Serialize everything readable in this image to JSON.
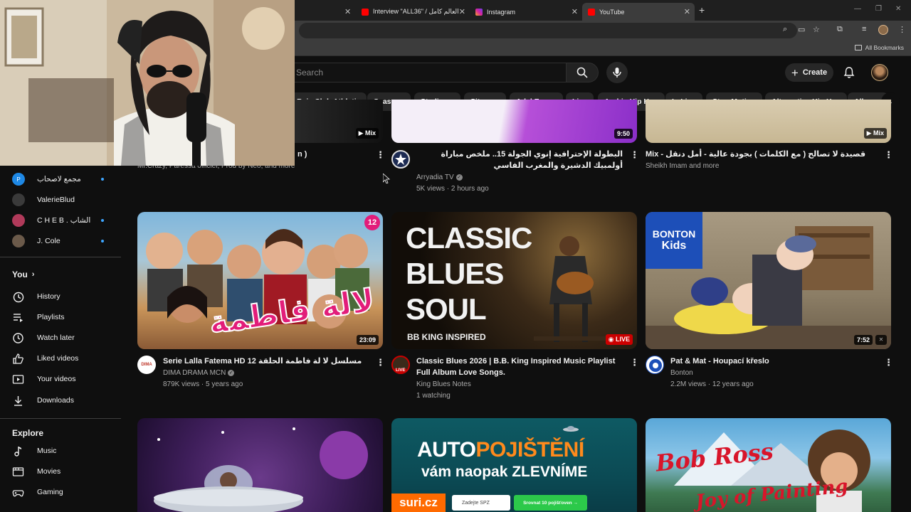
{
  "browser": {
    "tabs": [
      {
        "title": "Interview \"ALL36\" / العالم كامل ...",
        "favicon_color": "#ff0000"
      },
      {
        "title": "Instagram",
        "favicon_color": "#d6249f"
      },
      {
        "title": "YouTube",
        "favicon_color": "#ff0000",
        "active": true
      }
    ],
    "all_bookmarks": "All Bookmarks"
  },
  "header": {
    "search_placeholder": "Search",
    "create_label": "Create"
  },
  "chips": [
    "Raja Club Athletic",
    "Seasons",
    "Stadiums",
    "Sitcoms",
    "Adel Emam",
    "Live",
    "Arabic Hip Hop",
    "LaLiga",
    "Stop Motion",
    "Alternative Hip Hop",
    "Albums"
  ],
  "sidebar": {
    "subscriptions": [
      {
        "name": "مجمع لاصحاب",
        "color": "#1e88e5",
        "dot": true
      },
      {
        "name": "ValerieBlud",
        "color": "#3a3a3a",
        "dot": false
      },
      {
        "name": "C H E B . الشاب",
        "color": "#b03a5a",
        "dot": true
      },
      {
        "name": "J. Cole",
        "color": "#6b5a4a",
        "dot": true
      }
    ],
    "you_label": "You",
    "you_items": [
      {
        "label": "History",
        "icon": "history-icon"
      },
      {
        "label": "Playlists",
        "icon": "playlists-icon"
      },
      {
        "label": "Watch later",
        "icon": "watch-later-icon"
      },
      {
        "label": "Liked videos",
        "icon": "liked-icon"
      },
      {
        "label": "Your videos",
        "icon": "your-videos-icon"
      },
      {
        "label": "Downloads",
        "icon": "downloads-icon"
      }
    ],
    "explore_label": "Explore",
    "explore_items": [
      {
        "label": "Music",
        "icon": "music-icon"
      },
      {
        "label": "Movies",
        "icon": "movies-icon"
      },
      {
        "label": "Gaming",
        "icon": "gaming-icon"
      }
    ]
  },
  "row1": [
    {
      "title": "n )",
      "channel": "Mr.Crazy, Paressa officiel, Prod by Neo, and more",
      "badge": "Mix"
    },
    {
      "title": "البطولة الإحترافية إنوي الجولة 15.. ملخص مباراة أولمبيك الدشيرة والمغرب الفاسي",
      "channel": "Arryadia TV",
      "views": "5K views",
      "age": "2 hours ago",
      "duration": "9:50"
    },
    {
      "title": "Mix - قصيدة لا تصالح ( مع الكلمات ) بجودة عالية - أمل دنقل",
      "channel": "Sheikh Imam and more",
      "badge": "Mix"
    }
  ],
  "row2": [
    {
      "title": "Serie Lalla Fatema HD 12 مسلسل لا لة فاطمة الحلقة",
      "channel": "DIMA DRAMA MCN",
      "views": "879K views",
      "age": "5 years ago",
      "duration": "23:09",
      "thumb_text": "لالة فاطمة",
      "thumb_num": "12",
      "avatar_text": "DIMA"
    },
    {
      "title": "Classic Blues 2026 | B.B. King Inspired Music Playlist Full Album Love Songs.",
      "channel": "King Blues Notes",
      "views": "1 watching",
      "live": "LIVE",
      "thumb_lines": [
        "CLASSIC",
        "BLUES",
        "SOUL"
      ],
      "thumb_sub": "BB KING INSPIRED",
      "avatar_text": "LIVE"
    },
    {
      "title": "Pat & Mat - Houpací křeslo",
      "channel": "Bonton",
      "views": "2.2M views",
      "age": "12 years ago",
      "duration": "7:52",
      "logo_top": "BONTON",
      "logo_bottom": "Kids"
    }
  ],
  "row3": [
    {
      "kind": "cartoon"
    },
    {
      "line1a": "AUTO",
      "line1b": "POJIŠTĚNÍ",
      "line2a": "vám naopak ",
      "line2b": "ZLEVNÍME",
      "brand": "suri.cz",
      "field": "Zadejte SPZ",
      "cta": "Srovnat 10 pojišťoven →"
    },
    {
      "script_top": "Bob Ross",
      "script_bottom": "Joy of Painting"
    }
  ]
}
